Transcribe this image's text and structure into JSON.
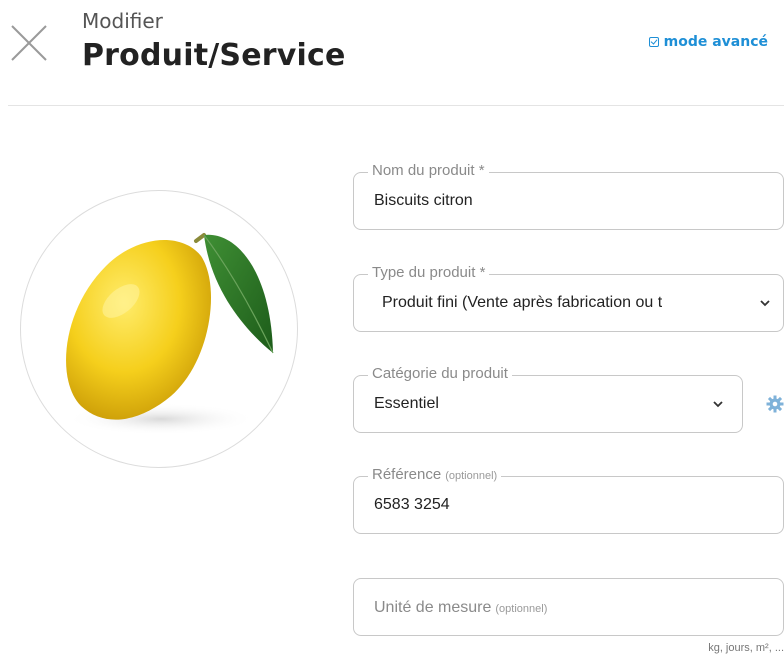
{
  "header": {
    "subtitle": "Modifier",
    "title": "Produit/Service",
    "advanced_mode_label": "mode avancé"
  },
  "product_image": {
    "subject": "lemon-icon"
  },
  "form": {
    "name": {
      "label": "Nom du produit *",
      "value": "Biscuits citron"
    },
    "type": {
      "label": "Type du produit *",
      "value": "Produit fini (Vente après fabrication ou t"
    },
    "category": {
      "label": "Catégorie du produit",
      "value": "Essentiel"
    },
    "reference": {
      "label": "Référence",
      "optional": "(optionnel)",
      "value": "6583 3254"
    },
    "unit": {
      "placeholder": "Unité de mesure",
      "optional": "(optionnel)",
      "hint": "kg, jours, m², ..."
    }
  },
  "colors": {
    "accent": "#1e8fd6",
    "border": "#c8c8c8"
  }
}
